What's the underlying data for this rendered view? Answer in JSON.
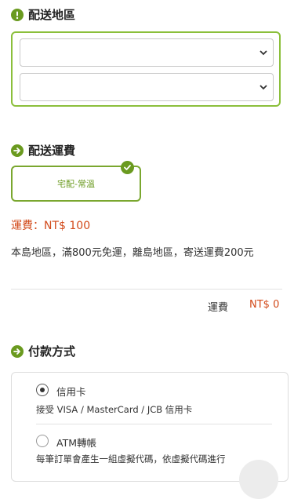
{
  "region": {
    "title": "配送地區",
    "select1_value": "",
    "select2_value": ""
  },
  "shipping": {
    "title": "配送運費",
    "option_label": "宅配-常溫",
    "fee_label": "運費：",
    "fee_value": "NT$ 100",
    "note": "本島地區，滿800元免運，離島地區，寄送運費200元"
  },
  "summary": {
    "label": "運費",
    "value": "NT$ 0"
  },
  "payment": {
    "title": "付款方式",
    "options": [
      {
        "label": "信用卡",
        "desc": "接受 VISA / MasterCard / JCB 信用卡",
        "selected": true
      },
      {
        "label": "ATM轉帳",
        "desc": "每筆訂單會產生一組虛擬代碼，依虛擬代碼進行",
        "selected": false
      }
    ]
  },
  "colors": {
    "accent": "#6a9a1f",
    "border_green": "#8bbf3b",
    "price_red": "#d24a1a"
  },
  "icons": {
    "region": "exclamation-circle-icon",
    "shipping": "arrow-right-circle-icon",
    "payment": "arrow-right-circle-icon",
    "selected": "check-circle-icon",
    "dropdown": "chevron-down-icon"
  }
}
